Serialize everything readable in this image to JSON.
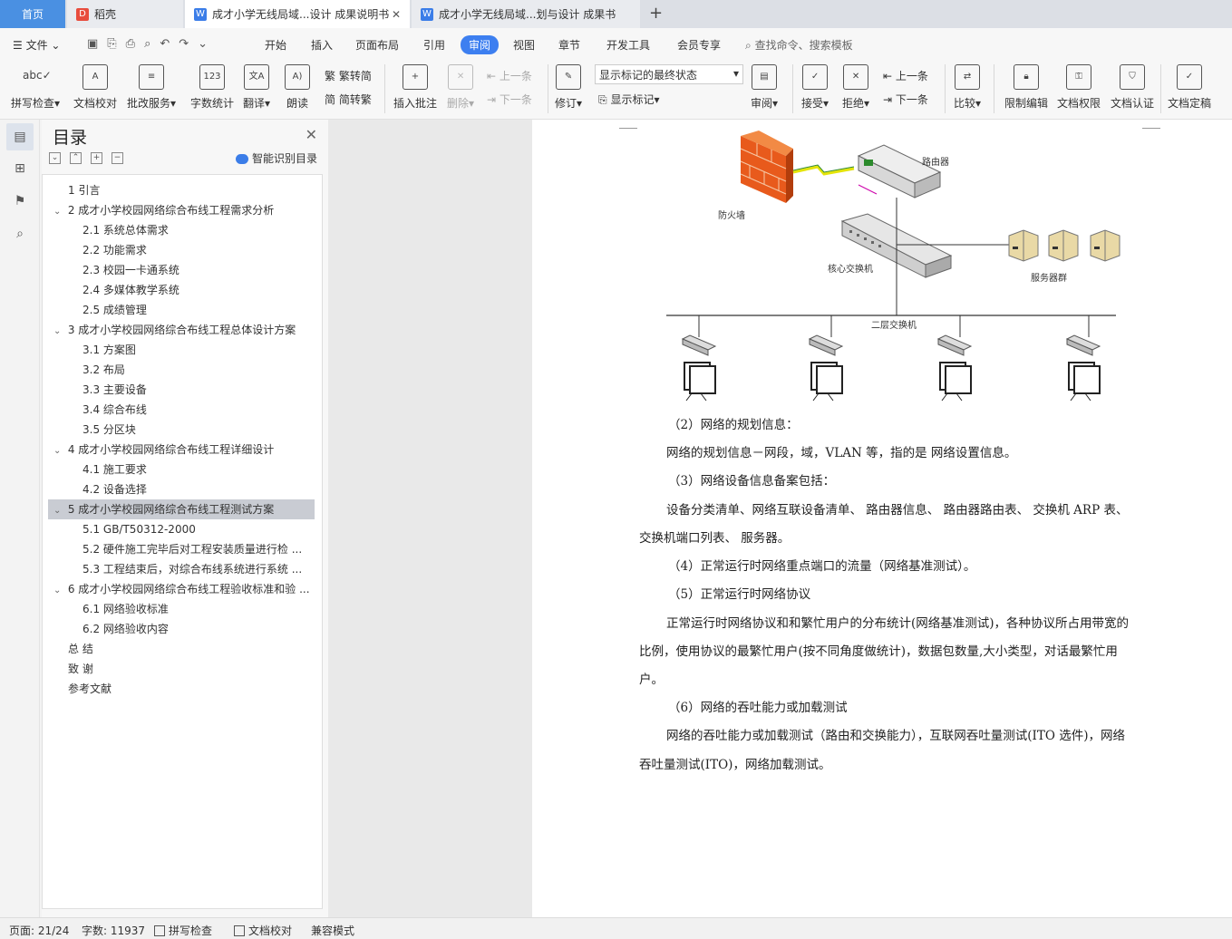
{
  "tabs": {
    "home": "首页",
    "t1": "稻壳",
    "t2": "成才小学无线局域...设计 成果说明书",
    "t3": "成才小学无线局域...划与设计 成果书"
  },
  "menu": {
    "file": "文件",
    "items": [
      "开始",
      "插入",
      "页面布局",
      "引用",
      "审阅",
      "视图",
      "章节",
      "开发工具",
      "会员专享"
    ],
    "search": "查找命令、搜索模板"
  },
  "ribbon": {
    "spell": "拼写检查",
    "doccheck": "文档校对",
    "batch": "批改服务",
    "wordcount": "字数统计",
    "translate": "翻译",
    "read": "朗读",
    "t2s": "繁转简",
    "s2t": "简转繁",
    "insert_comment": "插入批注",
    "delete": "删除",
    "prev": "上一条",
    "next": "下一条",
    "revise": "修订",
    "markup_state": "显示标记的最终状态",
    "show_markup": "显示标记",
    "review": "审阅",
    "accept": "接受",
    "reject": "拒绝",
    "prev2": "上一条",
    "next2": "下一条",
    "compare": "比较",
    "restrict": "限制编辑",
    "perm": "文档权限",
    "cert": "文档认证",
    "final": "文档定稿"
  },
  "toc": {
    "title": "目录",
    "ai": "智能识别目录",
    "items": [
      "1 引言",
      "2 成才小学校园网络综合布线工程需求分析",
      "2.1  系统总体需求",
      "2.2  功能需求",
      "2.3  校园一卡通系统",
      "2.4  多媒体教学系统",
      "2.5  成绩管理",
      "3 成才小学校园网络综合布线工程总体设计方案",
      "3.1  方案图",
      "3.2  布局",
      "3.3  主要设备",
      "3.4  综合布线",
      "3.5  分区块",
      "4 成才小学校园网络综合布线工程详细设计",
      "4.1  施工要求",
      "4.2  设备选择",
      "5 成才小学校园网络综合布线工程测试方案",
      "5.1 GB/T50312-2000",
      "5.2  硬件施工完毕后对工程安装质量进行检 ...",
      "5.3  工程结束后，对综合布线系统进行系统 ...",
      "6 成才小学校园网络综合布线工程验收标准和验 ...",
      "6.1  网络验收标准",
      "6.2 网络验收内容",
      "总   结",
      "致   谢",
      "参考文献"
    ]
  },
  "diagram": {
    "firewall": "防火墙",
    "router": "路由器",
    "core_switch": "核心交换机",
    "servers": "服务器群",
    "l2_switch": "二层交换机"
  },
  "doc": {
    "p1": "（2）网络的规划信息：",
    "p2": "网络的规划信息－网段，域，VLAN 等，指的是 网络设置信息。",
    "p3": "（3）网络设备信息备案包括：",
    "p4a": "设备分类清单、网络互联设备清单、 路由器信息、 路由器路由表、 交换机 ARP 表、",
    "p4b": "交换机端口列表、 服务器。",
    "p5": "（4）正常运行时网络重点端口的流量（网络基准测试）。",
    "p6": "（5）正常运行时网络协议",
    "p7a": "正常运行时网络协议和和繁忙用户的分布统计(网络基准测试)，各种协议所占用带宽的",
    "p7b": "比例，使用协议的最繁忙用户(按不同角度做统计)，数据包数量,大小类型，对话最繁忙用",
    "p7c": "户。",
    "p8": "（6）网络的吞吐能力或加载测试",
    "p9a": "网络的吞吐能力或加载测试（路由和交换能力），互联网吞吐量测试(ITO 选件)，网络",
    "p9b": "吞吐量测试(ITO)，网络加载测试。"
  },
  "status": {
    "page": "页面: 21/24",
    "words": "字数: 11937",
    "spell": "拼写检查",
    "doccheck": "文档校对",
    "compat": "兼容模式"
  }
}
